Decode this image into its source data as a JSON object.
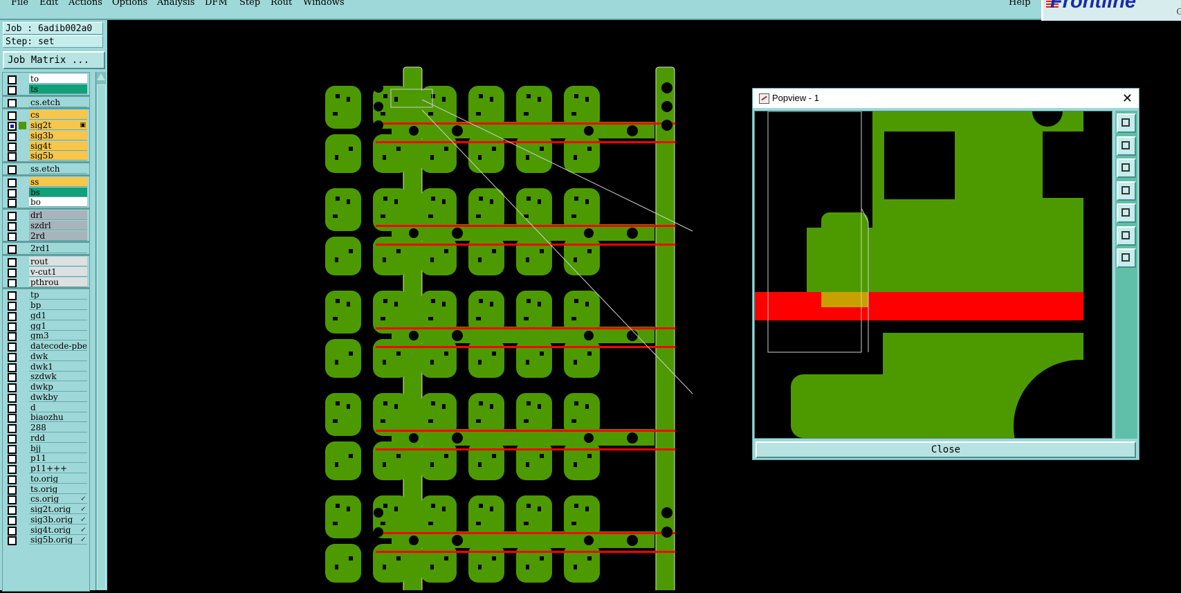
{
  "menu": {
    "items": [
      "File",
      "Edit",
      "Actions",
      "Options",
      "Analysis",
      "DFM",
      "Step",
      "Rout",
      "Windows"
    ],
    "help": "Help"
  },
  "logo": {
    "text": "Frontline",
    "suffix": "G"
  },
  "info": {
    "job": "Job : 6adib002a0",
    "step": "Step: set"
  },
  "job_matrix_label": "Job Matrix ...",
  "layers": [
    {
      "name": "to",
      "color": "#ffffff"
    },
    {
      "name": "ts",
      "color": "#12a07a"
    },
    {
      "sep": true
    },
    {
      "name": "cs.etch",
      "color": "#9fd8d8"
    },
    {
      "sep": true
    },
    {
      "name": "cs",
      "color": "#f7c64a"
    },
    {
      "name": "sig2t",
      "color": "#f7c64a",
      "active": true,
      "mark": "▣"
    },
    {
      "name": "sig3b",
      "color": "#f7c64a"
    },
    {
      "name": "sig4t",
      "color": "#f7c64a"
    },
    {
      "name": "sig5b",
      "color": "#f7c64a"
    },
    {
      "sep": true
    },
    {
      "name": "ss.etch",
      "color": "#9fd8d8"
    },
    {
      "sep": true
    },
    {
      "name": "ss",
      "color": "#f7c64a"
    },
    {
      "name": "bs",
      "color": "#12a07a"
    },
    {
      "name": "bo",
      "color": "#ffffff"
    },
    {
      "sep": true
    },
    {
      "name": "drl",
      "color": "#a8b4bc"
    },
    {
      "name": "szdrl",
      "color": "#a8b4bc"
    },
    {
      "name": "2rd",
      "color": "#a8b4bc"
    },
    {
      "sep": true
    },
    {
      "name": "2rd1",
      "color": "#9fd8d8"
    },
    {
      "sep": true
    },
    {
      "name": "rout",
      "color": "#dde0e0"
    },
    {
      "name": "v-cut1",
      "color": "#dde0e0"
    },
    {
      "name": "pthrou",
      "color": "#dde0e0"
    },
    {
      "sep": true
    },
    {
      "name": "tp",
      "color": "#9fd8d8"
    },
    {
      "name": "bp",
      "color": "#9fd8d8"
    },
    {
      "name": "gd1",
      "color": "#9fd8d8"
    },
    {
      "name": "gg1",
      "color": "#9fd8d8"
    },
    {
      "name": "gm3",
      "color": "#9fd8d8"
    },
    {
      "name": "datecode-pbe",
      "color": "#9fd8d8"
    },
    {
      "name": "dwk",
      "color": "#9fd8d8"
    },
    {
      "name": "dwk1",
      "color": "#9fd8d8"
    },
    {
      "name": "szdwk",
      "color": "#9fd8d8"
    },
    {
      "name": "dwkp",
      "color": "#9fd8d8"
    },
    {
      "name": "dwkby",
      "color": "#9fd8d8"
    },
    {
      "name": "d",
      "color": "#9fd8d8"
    },
    {
      "name": "biaozhu",
      "color": "#9fd8d8"
    },
    {
      "name": "288",
      "color": "#9fd8d8"
    },
    {
      "name": "rdd",
      "color": "#9fd8d8"
    },
    {
      "name": "bjj",
      "color": "#9fd8d8"
    },
    {
      "name": "p11",
      "color": "#9fd8d8"
    },
    {
      "name": "p11+++",
      "color": "#9fd8d8"
    },
    {
      "name": "to.orig",
      "color": "#9fd8d8"
    },
    {
      "name": "ts.orig",
      "color": "#9fd8d8"
    },
    {
      "name": "cs.orig",
      "color": "#9fd8d8",
      "mark": "↙"
    },
    {
      "name": "sig2t.orig",
      "color": "#9fd8d8",
      "mark": "↙"
    },
    {
      "name": "sig3b.orig",
      "color": "#9fd8d8",
      "mark": "↙"
    },
    {
      "name": "sig4t.orig",
      "color": "#9fd8d8",
      "mark": "↙"
    },
    {
      "name": "sig5b.orig",
      "color": "#9fd8d8",
      "mark": "↙"
    }
  ],
  "popview": {
    "title": "Popview - 1",
    "close_x": "✕",
    "close_label": "Close",
    "tools": [
      "zoom-fit-icon",
      "zoom-in-icon",
      "zoom-out-icon",
      "pan-left-icon",
      "pan-right-icon",
      "fit-all-icon",
      "center-icon"
    ]
  },
  "colors": {
    "copper": "#4c9a00",
    "signal": "#ff0000",
    "overlap": "#c8a000",
    "ui": "#9fd8d8"
  }
}
